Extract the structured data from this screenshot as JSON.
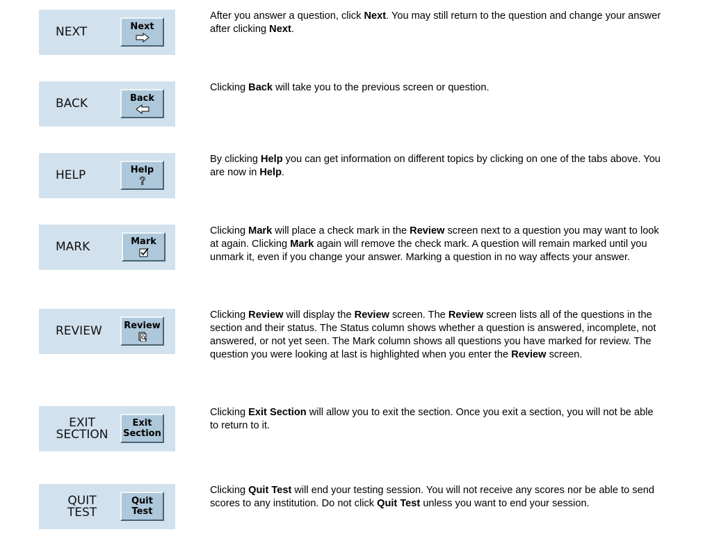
{
  "rows": [
    {
      "label": "NEXT",
      "button_label": "Next",
      "icon": "arrow-right-icon",
      "description": [
        {
          "t": "After you answer a question, click "
        },
        {
          "t": "Next",
          "b": true
        },
        {
          "t": ". You may still return to the question and change your answer after clicking "
        },
        {
          "t": "Next",
          "b": true
        },
        {
          "t": "."
        }
      ]
    },
    {
      "label": "BACK",
      "button_label": "Back",
      "icon": "arrow-left-icon",
      "description": [
        {
          "t": "Clicking "
        },
        {
          "t": "Back",
          "b": true
        },
        {
          "t": " will take you to the previous screen or question."
        }
      ]
    },
    {
      "label": "HELP",
      "button_label": "Help",
      "icon": "question-mark-icon",
      "description": [
        {
          "t": "By clicking "
        },
        {
          "t": "Help",
          "b": true
        },
        {
          "t": " you can get information on different topics by clicking on one of the tabs above. You are now in "
        },
        {
          "t": "Help",
          "b": true
        },
        {
          "t": "."
        }
      ]
    },
    {
      "label": "MARK",
      "button_label": "Mark",
      "icon": "checkbox-checked-icon",
      "description": [
        {
          "t": "Clicking "
        },
        {
          "t": "Mark",
          "b": true
        },
        {
          "t": " will place a check mark in the "
        },
        {
          "t": "Review",
          "b": true
        },
        {
          "t": " screen next to a question you may want to look at again. Clicking "
        },
        {
          "t": "Mark",
          "b": true
        },
        {
          "t": " again will remove the check mark. A question will remain marked until you unmark it, even if you change your answer. Marking a question in no way affects your answer."
        }
      ]
    },
    {
      "label": "REVIEW",
      "button_label": "Review",
      "icon": "review-document-icon",
      "description": [
        {
          "t": "Clicking "
        },
        {
          "t": "Review",
          "b": true
        },
        {
          "t": " will display the "
        },
        {
          "t": "Review",
          "b": true
        },
        {
          "t": " screen. The "
        },
        {
          "t": "Review",
          "b": true
        },
        {
          "t": " screen lists all of the questions in the section and their status. The Status column shows whether a question is answered, incomplete, not answered, or not yet seen. The Mark column shows all questions you have marked for review. The question you were looking at last is highlighted when you enter the "
        },
        {
          "t": "Review",
          "b": true
        },
        {
          "t": " screen."
        }
      ]
    },
    {
      "label_lines": [
        "EXIT",
        "SECTION"
      ],
      "button_lines": [
        "Exit",
        "Section"
      ],
      "description": [
        {
          "t": "Clicking "
        },
        {
          "t": "Exit Section",
          "b": true
        },
        {
          "t": " will allow you to exit the section. Once you exit a section, you will not be able to return to it."
        }
      ]
    },
    {
      "label_lines": [
        "QUIT",
        "TEST"
      ],
      "button_lines": [
        "Quit",
        "Test"
      ],
      "description": [
        {
          "t": "Clicking "
        },
        {
          "t": "Quit Test",
          "b": true
        },
        {
          "t": " will end your testing session. You will not receive any scores nor be able to send scores to any institution. Do not click "
        },
        {
          "t": "Quit Test",
          "b": true
        },
        {
          "t": " unless you want to end your session."
        }
      ]
    }
  ]
}
